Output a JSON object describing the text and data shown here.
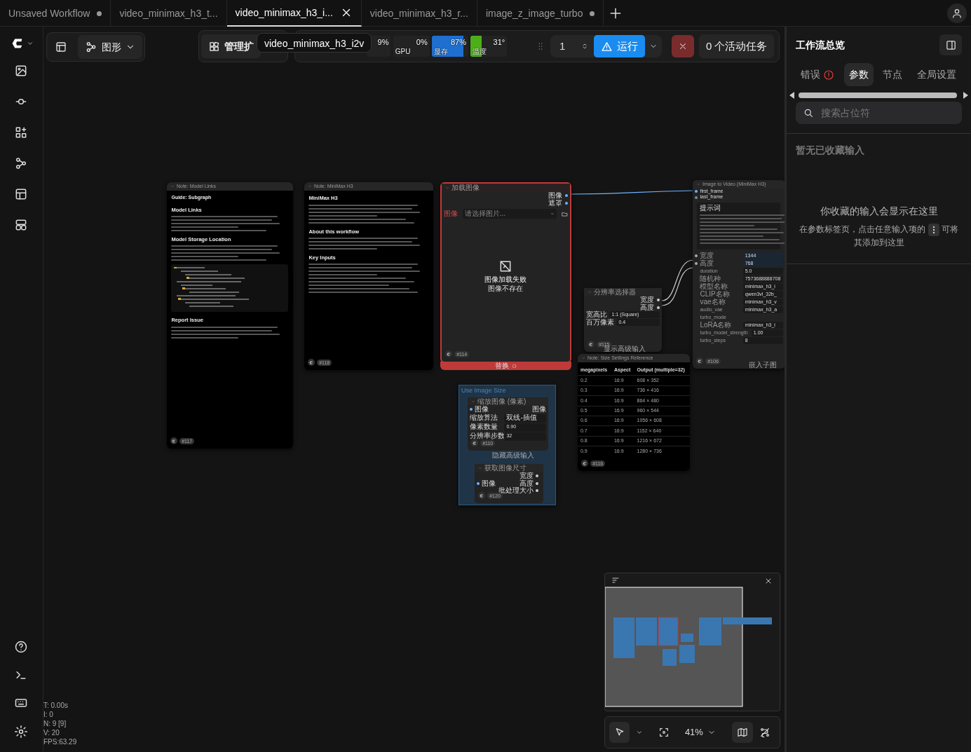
{
  "tabs": [
    {
      "label": "Unsaved Workflow",
      "selected": false,
      "modified": true
    },
    {
      "label": "video_minimax_h3_t...",
      "selected": false,
      "modified": false
    },
    {
      "label": "video_minimax_h3_i...",
      "selected": true,
      "modified": false
    },
    {
      "label": "video_minimax_h3_r...",
      "selected": false,
      "modified": false
    },
    {
      "label": "image_z_image_turbo",
      "selected": false,
      "modified": true
    }
  ],
  "toolbar": {
    "view_label": "图形",
    "extensions_label": "管理扩",
    "tooltip": "video_minimax_h3_i2v",
    "monitors": [
      {
        "reading": "9%"
      },
      {
        "label": "GPU",
        "reading": "0%"
      },
      {
        "label": "显存",
        "reading": "87%",
        "level": 0.87,
        "color": "#1e6fd0"
      },
      {
        "label": "温度",
        "reading": "31°",
        "level": 0.31,
        "color": "#4caf1a"
      }
    ],
    "run_count": "1",
    "run_label": "运行",
    "active_jobs": "0 个活动任务"
  },
  "nodes": [
    {
      "kind": "note",
      "title": "Note: Model Links",
      "badge": "#117",
      "headings": [
        "Guide: Subgraph",
        "Model Links",
        "Model Storage Location",
        "Report Issue"
      ]
    },
    {
      "kind": "note",
      "title": "Note: MiniMax H3",
      "badge": "#118",
      "headings": [
        "MiniMax H3",
        "About this workflow",
        "Key Inputs"
      ]
    },
    {
      "kind": "load_image",
      "title": "加载图像",
      "error": true,
      "outputs": [
        "图像",
        "遮罩"
      ],
      "widget_label": "图像",
      "select_placeholder": "请选择图片...",
      "message": "图像加载失败",
      "detail": "图像不存在",
      "badge": "#114",
      "footer": "替换"
    },
    {
      "kind": "i2v",
      "title": "Image to Video (MiniMax H3)",
      "inputs": [
        "first_frame",
        "last_frame"
      ],
      "prompt_label": "提示词",
      "rows": [
        {
          "label": "宽度",
          "value": "1344",
          "linked": true
        },
        {
          "label": "高度",
          "value": "768",
          "linked": true
        },
        {
          "label": "duration",
          "value": "5.0",
          "linked": false
        },
        {
          "label": "随机种",
          "value": "7573688888708",
          "linked": false
        },
        {
          "label": "模型名称",
          "value": "minimax_h3_i",
          "linked": false
        },
        {
          "label": "CLIP名称",
          "value": "qwen3vl_32b_",
          "linked": false
        },
        {
          "label": "vae名称",
          "value": "minimax_h3_v",
          "linked": false
        },
        {
          "label": "audio_vae",
          "value": "minimax_h3_a",
          "linked": false
        },
        {
          "label": "turbo_mode",
          "linked": false
        },
        {
          "label": "LoRA名称",
          "value": "minimax_h3_i",
          "linked": false
        },
        {
          "label": "turbo_model_strength",
          "value": "1.00",
          "linked": false
        },
        {
          "label": "turbo_steps",
          "value": "8",
          "linked": false
        }
      ],
      "badge": "#106",
      "footer": "嵌入子图"
    },
    {
      "kind": "resolution",
      "title": "分辨率选择器",
      "outputs": [
        "宽度",
        "高度"
      ],
      "rows": [
        {
          "label": "宽高比",
          "value": "1:1 (Square)"
        },
        {
          "label": "百万像素",
          "value": "0.4"
        }
      ],
      "badge": "#115",
      "footer": "显示高级输入"
    },
    {
      "kind": "table_note",
      "title": "Note: Size Settings Reference",
      "columns": [
        "megapixels",
        "Aspect",
        "Output (multiple=32)"
      ],
      "rows": [
        [
          "0.2",
          "16:9",
          "608 × 352"
        ],
        [
          "0.3",
          "16:9",
          "736 × 416"
        ],
        [
          "0.4",
          "16:9",
          "864 × 480"
        ],
        [
          "0.5",
          "16:9",
          "960 × 544"
        ],
        [
          "0.6",
          "16:9",
          "1056 × 608"
        ],
        [
          "0.7",
          "16:9",
          "1152 × 640"
        ],
        [
          "0.8",
          "16:9",
          "1216 × 672"
        ],
        [
          "0.9",
          "16:9",
          "1280 × 736"
        ]
      ],
      "badge": "#116"
    },
    {
      "kind": "group",
      "title": "Use Image Size",
      "inner": [
        {
          "title": "缩放图像 (像素)",
          "input": "图像",
          "output": "图像",
          "rows": [
            {
              "label": "缩放算法",
              "value": "双线-插值"
            },
            {
              "label": "像素数量",
              "value": "0.90"
            },
            {
              "label": "分辨率步数",
              "value": "32"
            }
          ],
          "badge": "#110",
          "footer": "隐藏高级输入"
        },
        {
          "title": "获取图像尺寸",
          "input": "图像",
          "outputs": [
            "宽度",
            "高度",
            "批处理大小"
          ],
          "badge": "#120"
        }
      ]
    }
  ],
  "panel": {
    "title": "工作流总览",
    "tabs": [
      {
        "label": "错误",
        "selected": false,
        "alert": true
      },
      {
        "label": "参数",
        "selected": true,
        "alert": false
      },
      {
        "label": "节点",
        "selected": false,
        "alert": false
      },
      {
        "label": "全局设置",
        "selected": false,
        "alert": false
      }
    ],
    "search_placeholder": "搜索占位符",
    "section": "暂无已收藏输入",
    "empty_title": "你收藏的输入会显示在这里",
    "hint_before": "在参数标签页，点击任意输入项的",
    "hint_after": "可将",
    "hint_last": "其添加到这里"
  },
  "stats": [
    "T: 0.00s",
    "I: 0",
    "N: 9 [9]",
    "V: 20",
    "FPS:63.29"
  ],
  "zoom_level": "41%",
  "map_selected": true
}
